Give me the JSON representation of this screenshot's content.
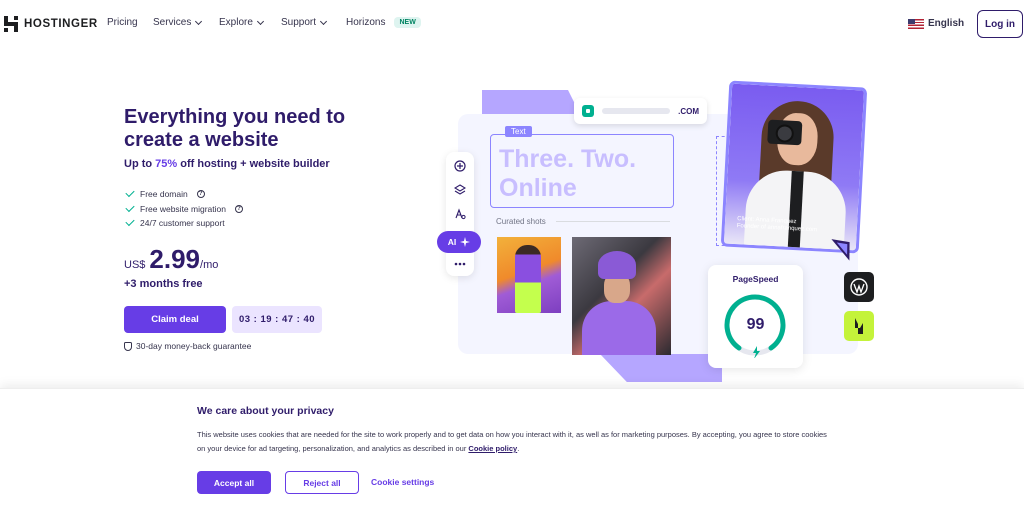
{
  "nav": {
    "logo": "HOSTINGER",
    "items": [
      {
        "label": "Pricing",
        "has_dropdown": false
      },
      {
        "label": "Services",
        "has_dropdown": true
      },
      {
        "label": "Explore",
        "has_dropdown": true
      },
      {
        "label": "Support",
        "has_dropdown": true
      },
      {
        "label": "Horizons",
        "has_dropdown": false,
        "badge": "NEW"
      }
    ],
    "language": "English",
    "language_icon": "us-flag-icon",
    "login": "Log in"
  },
  "hero": {
    "title": "Everything you need to create a website",
    "subtitle_prefix": "Up to ",
    "subtitle_highlight": "75%",
    "subtitle_suffix": " off hosting + website builder",
    "features": [
      {
        "label": "Free domain",
        "has_help": true
      },
      {
        "label": "Free website migration",
        "has_help": true
      },
      {
        "label": "24/7 customer support",
        "has_help": false
      }
    ],
    "price": {
      "currency": "US$",
      "amount": "2.99",
      "period": "/mo"
    },
    "bonus": "+3 months free",
    "cta": "Claim deal",
    "countdown": "03 : 19 : 47 : 40",
    "guarantee": "30-day money-back guarantee"
  },
  "illustration": {
    "url_domain": ".COM",
    "text_tag": "Text",
    "headline": "Three. Two. Online",
    "curated_label": "Curated shots",
    "ai_label": "AI",
    "portrait_caption_line1": "Client: Anna Franquez",
    "portrait_caption_line2": "Founder of annafranquez.com",
    "pagespeed_label": "PageSpeed",
    "pagespeed_score": "99",
    "tool_icons": [
      "plus-circle-icon",
      "layers-icon",
      "text-style-icon",
      "more-icon"
    ],
    "tile_icons": [
      "wordpress-icon",
      "litespeed-icon"
    ]
  },
  "cookie": {
    "title": "We care about your privacy",
    "text": "This website uses cookies that are needed for the site to work properly and to get data on how you interact with it, as well as for marketing purposes. By accepting, you agree to store cookies on your device for ad targeting, personalization, and analytics as described in our ",
    "link": "Cookie policy",
    "text_end": ".",
    "accept": "Accept all",
    "reject": "Reject all",
    "settings": "Cookie settings"
  },
  "colors": {
    "brand": "#673de6",
    "heading": "#2f1c6a",
    "accent_soft": "#ebe4ff",
    "success": "#00b090"
  }
}
